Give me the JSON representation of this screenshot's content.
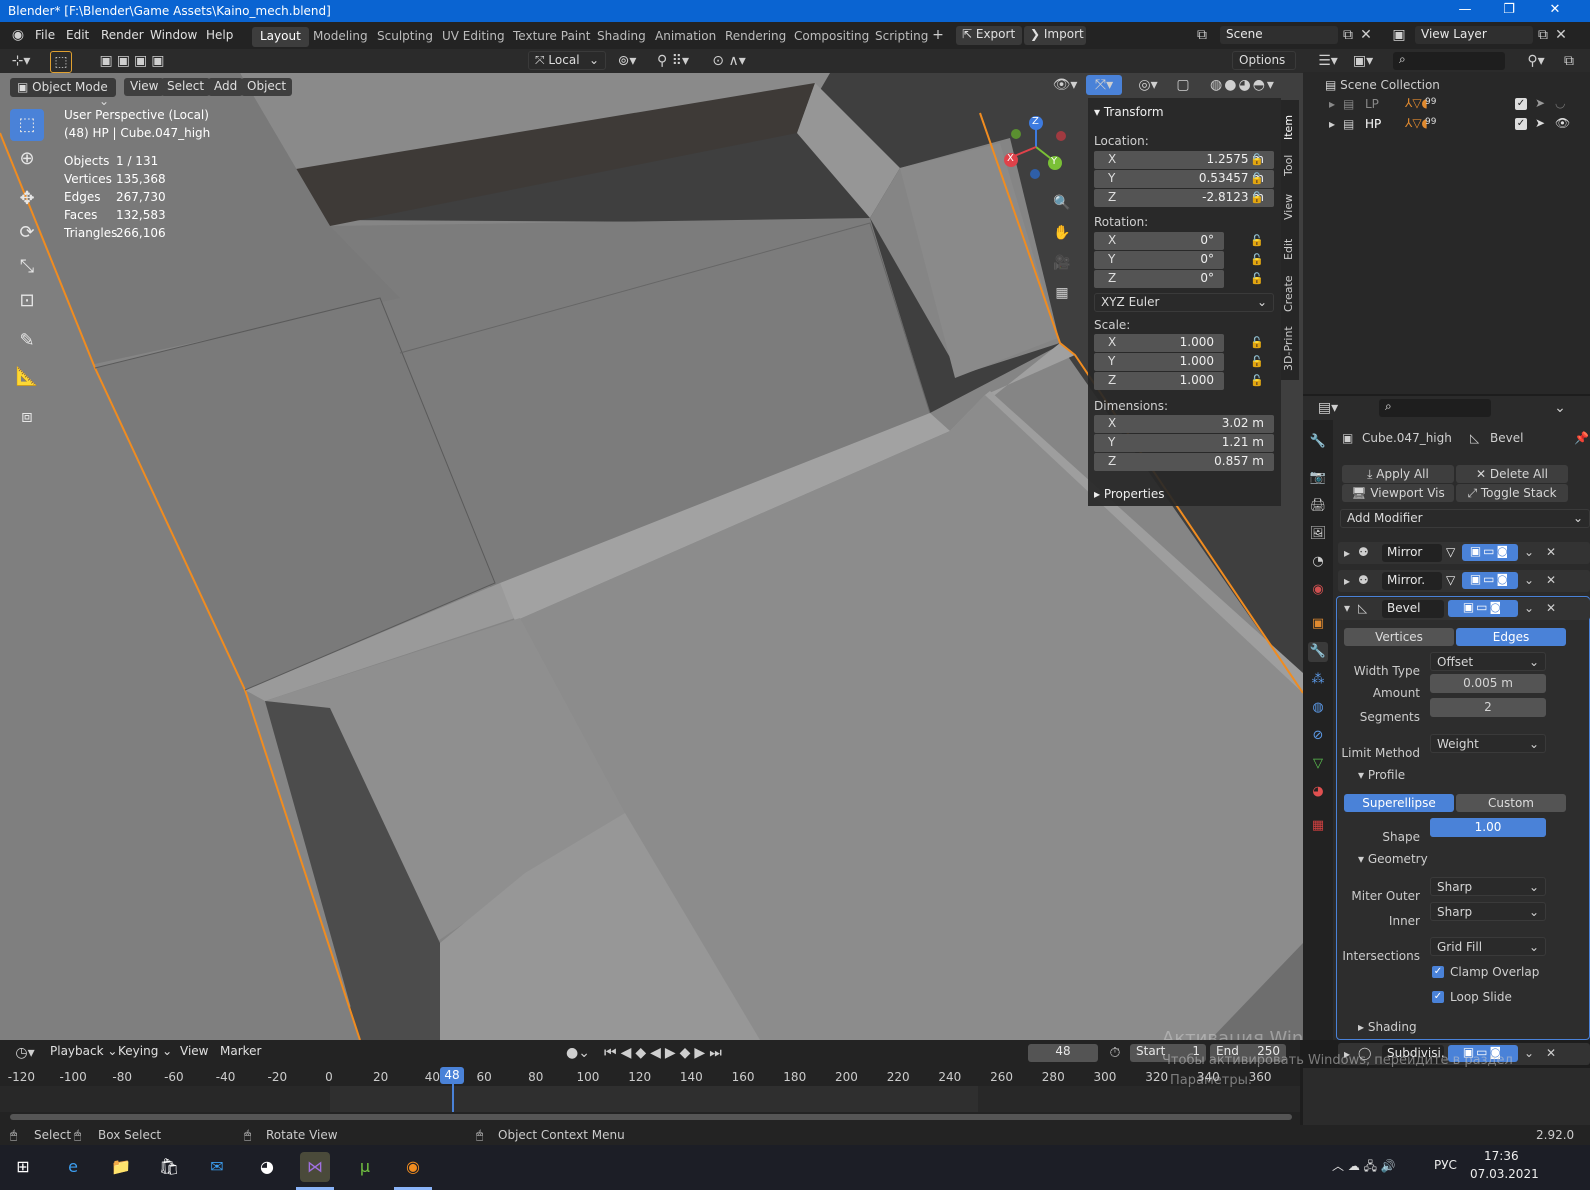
{
  "window": {
    "title": "Blender* [F:\\Blender\\Game Assets\\Kaino_mech.blend]",
    "minimize": "—",
    "maximize": "❐",
    "close": "✕"
  },
  "menu": {
    "items": [
      "File",
      "Edit",
      "Render",
      "Window",
      "Help"
    ]
  },
  "workspaces": [
    "Layout",
    "Modeling",
    "Sculpting",
    "UV Editing",
    "Texture Paint",
    "Shading",
    "Animation",
    "Rendering",
    "Compositing",
    "Scripting"
  ],
  "addons": {
    "export": "Export",
    "import": "Import"
  },
  "scene": {
    "name": "Scene",
    "view_layer": "View Layer"
  },
  "viewport_header": {
    "transform_orientation": "Local",
    "options": "Options",
    "mode": "Object Mode",
    "menus": [
      "View",
      "Select",
      "Add",
      "Object"
    ]
  },
  "overlay_text": {
    "perspective": "User Perspective (Local)",
    "object": "(48) HP | Cube.047_high",
    "stats": [
      {
        "label": "Objects",
        "value": "1 / 131"
      },
      {
        "label": "Vertices",
        "value": "135,368"
      },
      {
        "label": "Edges",
        "value": "267,730"
      },
      {
        "label": "Faces",
        "value": "132,583"
      },
      {
        "label": "Triangles",
        "value": "266,106"
      }
    ]
  },
  "gizmo": {
    "x": "X",
    "y": "Y",
    "z": "Z"
  },
  "n_panel": {
    "transform_title": "Transform",
    "location_label": "Location:",
    "location": [
      {
        "axis": "X",
        "value": "1.2575 m"
      },
      {
        "axis": "Y",
        "value": "0.53457 m"
      },
      {
        "axis": "Z",
        "value": "-2.8123 m"
      }
    ],
    "rotation_label": "Rotation:",
    "rotation": [
      {
        "axis": "X",
        "value": "0°"
      },
      {
        "axis": "Y",
        "value": "0°"
      },
      {
        "axis": "Z",
        "value": "0°"
      }
    ],
    "rotation_mode": "XYZ Euler",
    "scale_label": "Scale:",
    "scale": [
      {
        "axis": "X",
        "value": "1.000"
      },
      {
        "axis": "Y",
        "value": "1.000"
      },
      {
        "axis": "Z",
        "value": "1.000"
      }
    ],
    "dimensions_label": "Dimensions:",
    "dimensions": [
      {
        "axis": "X",
        "value": "3.02 m"
      },
      {
        "axis": "Y",
        "value": "1.21 m"
      },
      {
        "axis": "Z",
        "value": "0.857 m"
      }
    ],
    "properties_title": "Properties",
    "tabs": [
      "Item",
      "Tool",
      "View",
      "Edit",
      "Create",
      "3D-Print"
    ]
  },
  "outliner": {
    "root": "Scene Collection",
    "collections": [
      {
        "name": "LP",
        "badge": "99"
      },
      {
        "name": "HP",
        "badge": "99"
      }
    ]
  },
  "properties": {
    "object_name": "Cube.047_high",
    "modifier_name_header": "Bevel",
    "apply_all": "Apply All",
    "delete_all": "Delete All",
    "viewport_vis": "Viewport Vis",
    "toggle_stack": "Toggle Stack",
    "add_modifier": "Add Modifier",
    "modifiers": [
      {
        "name": "Mirror"
      },
      {
        "name": "Mirror."
      }
    ],
    "bevel": {
      "name": "Bevel",
      "mode_vertices": "Vertices",
      "mode_edges": "Edges",
      "width_type_label": "Width Type",
      "width_type": "Offset",
      "amount_label": "Amount",
      "amount": "0.005 m",
      "segments_label": "Segments",
      "segments": "2",
      "limit_method_label": "Limit Method",
      "limit_method": "Weight",
      "profile_label": "Profile",
      "superellipse": "Superellipse",
      "custom": "Custom",
      "shape_label": "Shape",
      "shape": "1.00",
      "shape_fill": 1.0,
      "geometry_label": "Geometry",
      "miter_outer_label": "Miter Outer",
      "miter_outer": "Sharp",
      "inner_label": "Inner",
      "inner": "Sharp",
      "intersections_label": "Intersections",
      "intersections": "Grid Fill",
      "clamp_overlap": "Clamp Overlap",
      "loop_slide": "Loop Slide",
      "shading_label": "Shading"
    },
    "subdivision": "Subdivisi..."
  },
  "timeline": {
    "menus": [
      "Playback",
      "Keying",
      "View",
      "Marker"
    ],
    "current_frame": "48",
    "start_label": "Start",
    "start": "1",
    "end_label": "End",
    "end": "250",
    "ticks": [
      "-120",
      "-100",
      "-80",
      "-60",
      "-40",
      "-20",
      "0",
      "20",
      "40",
      "60",
      "80",
      "100",
      "120",
      "140",
      "160",
      "180",
      "200",
      "220",
      "240",
      "260",
      "280",
      "300",
      "320",
      "340",
      "360"
    ]
  },
  "status_bar": {
    "select": "Select",
    "box_select": "Box Select",
    "rotate_view": "Rotate View",
    "context_menu": "Object Context Menu",
    "version": "2.92.0"
  },
  "watermark": {
    "line1": "Активация Windows",
    "line2": "Чтобы активировать Windows, перейдите в раздел",
    "line3": "Параметры."
  },
  "taskbar": {
    "lang": "РУС",
    "time": "17:36",
    "date": "07.03.2021"
  },
  "colors": {
    "accent": "#4a82d8",
    "selection_orange": "#f08c20",
    "titlebar": "#0a64d2"
  }
}
